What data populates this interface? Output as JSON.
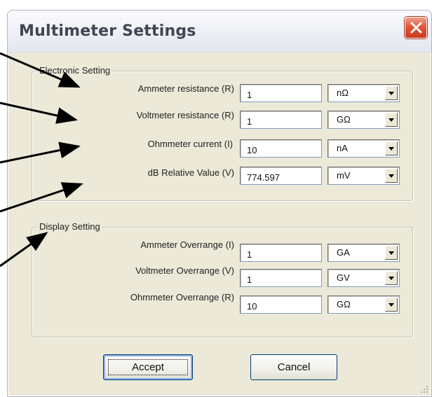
{
  "dialog": {
    "title": "Multimeter Settings",
    "close_icon": "close-icon"
  },
  "electronic_setting": {
    "label": "Electronic Setting",
    "rows": [
      {
        "label": "Ammeter resistance (R)",
        "value": "1",
        "unit": "nΩ"
      },
      {
        "label": "Voltmeter resistance (R)",
        "value": "1",
        "unit": "GΩ"
      },
      {
        "label": "Ohmmeter current (I)",
        "value": "10",
        "unit": "nA"
      },
      {
        "label": "dB Relative Value (V)",
        "value": "774.597",
        "unit": "mV"
      }
    ]
  },
  "display_setting": {
    "label": "Display Setting",
    "rows": [
      {
        "label": "Ammeter Overrange (I)",
        "value": "1",
        "unit": "GA"
      },
      {
        "label": "Voltmeter Overrange (V)",
        "value": "1",
        "unit": "GV"
      },
      {
        "label": "Ohmmeter Overrange (R)",
        "value": "10",
        "unit": "GΩ"
      }
    ]
  },
  "buttons": {
    "accept": "Accept",
    "cancel": "Cancel"
  },
  "colors": {
    "dialog_bg": "#ece9d8",
    "close_red": "#e2563b",
    "input_border": "#7f9db9",
    "button_border": "#003c74"
  }
}
